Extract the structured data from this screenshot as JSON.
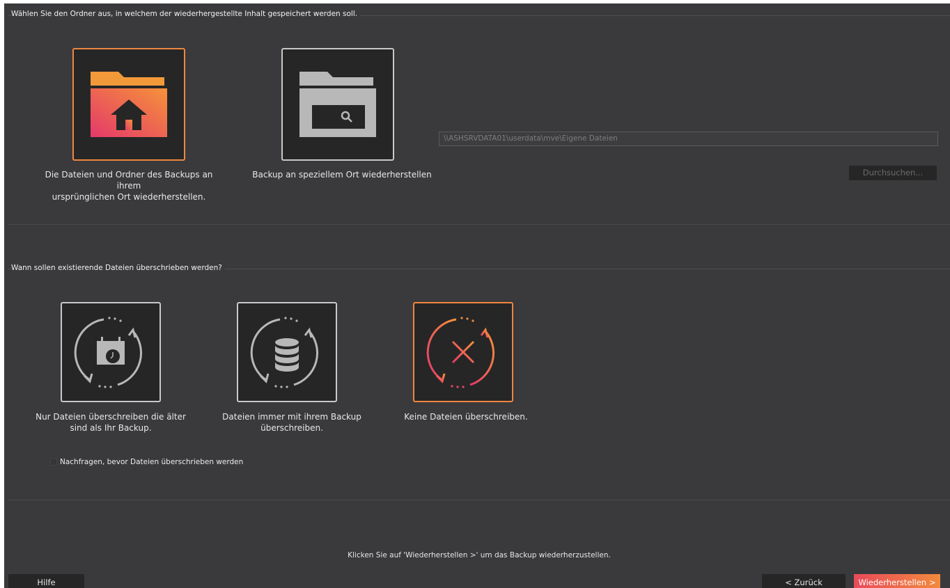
{
  "location_section": {
    "title": "Wählen Sie den Ordner aus, in welchem der wiederhergestellte Inhalt gespeichert werden soll.",
    "options": [
      {
        "icon": "folder-home-icon",
        "label_line1": "Die Dateien und Ordner des Backups an ihrem",
        "label_line2": "ursprünglichen Ort wiederherstellen.",
        "selected": true
      },
      {
        "icon": "folder-search-icon",
        "label_line1": "Backup an speziellem Ort wiederherstellen",
        "label_line2": "",
        "selected": false
      }
    ],
    "path_value": "\\\\ASHSRVDATA01\\userdata\\mve\\Eigene Dateien",
    "browse_label": "Durchsuchen..."
  },
  "overwrite_section": {
    "title": "Wann sollen existierende Dateien überschrieben werden?",
    "options": [
      {
        "icon": "sync-calendar-icon",
        "label_line1": "Nur Dateien überschreiben die älter",
        "label_line2": "sind als Ihr Backup.",
        "selected": false
      },
      {
        "icon": "sync-database-icon",
        "label_line1": "Dateien immer mit ihrem Backup",
        "label_line2": "überschreiben.",
        "selected": false
      },
      {
        "icon": "sync-cancel-icon",
        "label_line1": "Keine Dateien überschreiben.",
        "label_line2": "",
        "selected": true
      }
    ],
    "confirm_checkbox_label": "Nachfragen, bevor Dateien überschrieben werden",
    "confirm_checked": false
  },
  "footer": {
    "hint": "Klicken Sie auf 'Wiederherstellen >' um das Backup wiederherzustellen.",
    "help_label": "Hilfe",
    "back_label": "< Zurück",
    "restore_label": "Wiederherstellen >"
  },
  "colors": {
    "background": "#3a3a3c",
    "tile_bg": "#262626",
    "accent_start": "#ea4a5b",
    "accent_end": "#f28a3c",
    "tile_border_normal": "#c9c9c9"
  }
}
